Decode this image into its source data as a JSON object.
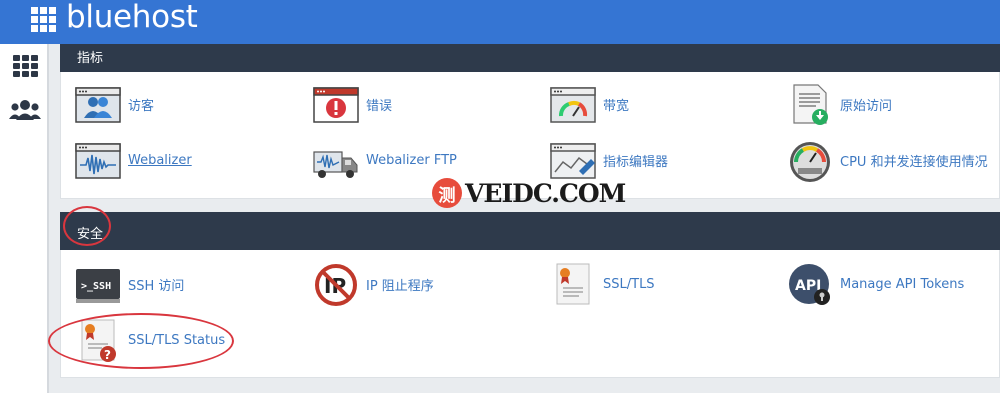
{
  "header": {
    "brand": "bluehost"
  },
  "sections": {
    "metrics": {
      "title": "指标",
      "items": [
        {
          "label": "访客"
        },
        {
          "label": "错误"
        },
        {
          "label": "带宽"
        },
        {
          "label": "原始访问"
        },
        {
          "label": "Webalizer"
        },
        {
          "label": "Webalizer FTP"
        },
        {
          "label": "指标编辑器"
        },
        {
          "label": "CPU 和并发连接使用情况"
        }
      ]
    },
    "security": {
      "title": "安全",
      "items": [
        {
          "label": "SSH 访问"
        },
        {
          "label": "IP 阻止程序"
        },
        {
          "label": "SSL/TLS"
        },
        {
          "label": "Manage API Tokens"
        },
        {
          "label": "SSL/TLS Status"
        }
      ]
    }
  },
  "watermark": {
    "badge": "测",
    "text": "VEIDC.COM"
  },
  "icons": {
    "ssh": ">_SSH",
    "ip": "IP",
    "api": "API",
    "question": "?"
  },
  "colors": {
    "topbar": "#3575d3",
    "panel_header": "#2e3a4b",
    "link": "#3d78c1",
    "annotation": "#d9363e"
  }
}
